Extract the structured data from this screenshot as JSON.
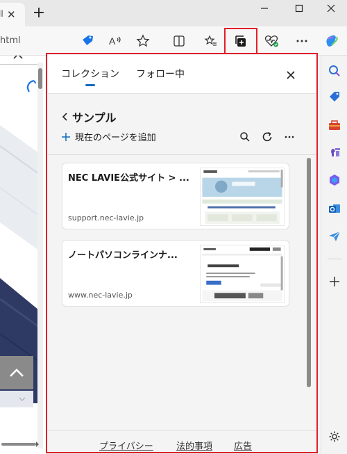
{
  "browser": {
    "tab_fragment": "ll",
    "address_fragment": "html"
  },
  "panel": {
    "tabs": [
      {
        "label": "コレクション",
        "active": true
      },
      {
        "label": "フォロー中",
        "active": false
      }
    ],
    "collection_title": "サンプル",
    "add_page_label": "現在のページを追加",
    "items": [
      {
        "title": "NEC LAVIE公式サイト > ...",
        "domain": "support.nec-lavie.jp"
      },
      {
        "title": "ノートパソコンラインナ...",
        "domain": "www.nec-lavie.jp"
      }
    ],
    "footer": {
      "privacy": "プライバシー",
      "legal": "法的事項",
      "ads": "広告"
    }
  },
  "colors": {
    "accent": "#0f6cbd",
    "highlight": "#e0202a"
  }
}
